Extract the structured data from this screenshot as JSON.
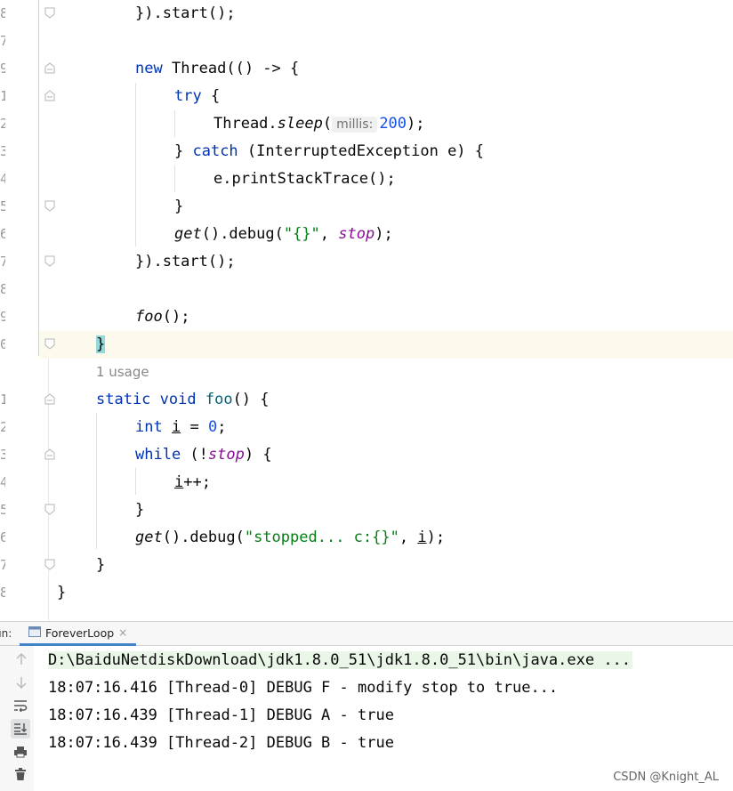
{
  "editor": {
    "line_numbers": [
      "8",
      "7",
      "9",
      "1",
      "2",
      "3",
      "4",
      "5",
      "6",
      "7",
      "8",
      "9",
      "0",
      "",
      "1",
      "2",
      "3",
      "4",
      "5",
      "6",
      "7",
      "8"
    ],
    "lines": {
      "l0": {
        "a": "}).start();"
      },
      "l2": {
        "kw": "new",
        "rest": " Thread(() -> {"
      },
      "l3": {
        "kw": "try",
        "rest": " {"
      },
      "l4": {
        "a": "Thread.",
        "it": "sleep",
        "b": "(",
        "hint": "millis:",
        "num": "200",
        "c": ");"
      },
      "l5": {
        "a": "} ",
        "kw": "catch",
        "rest": " (InterruptedException e) {"
      },
      "l6": {
        "a": "e.printStackTrace();"
      },
      "l7": {
        "a": "}"
      },
      "l8": {
        "it": "get",
        "a": "().debug(",
        "str": "\"{}\"",
        "b": ", ",
        "fld": "stop",
        "c": ");"
      },
      "l9": {
        "a": "}).start();"
      },
      "l11": {
        "it": "foo",
        "a": "();"
      },
      "l12": {
        "a": "}"
      },
      "l13": {
        "usage": "1 usage"
      },
      "l14": {
        "kw": "static void",
        "fn": "foo",
        "rest": "() {"
      },
      "l15": {
        "kw": "int",
        "var": "i",
        "a": " = ",
        "num": "0",
        "b": ";"
      },
      "l16": {
        "kw": "while",
        "a": " (!",
        "fld": "stop",
        "b": ") {"
      },
      "l17": {
        "var": "i",
        "a": "++;"
      },
      "l18": {
        "a": "}"
      },
      "l19": {
        "it": "get",
        "a": "().debug(",
        "str": "\"stopped... c:{}\"",
        "b": ", ",
        "var": "i",
        "c": ");"
      },
      "l20": {
        "a": "}"
      },
      "l21": {
        "a": "}"
      }
    }
  },
  "run_panel": {
    "label": "un:",
    "tab_title": "ForeverLoop",
    "tab_close": "×",
    "console_lines": [
      "D:\\BaiduNetdiskDownload\\jdk1.8.0_51\\jdk1.8.0_51\\bin\\java.exe ...",
      "18:07:16.416 [Thread-0] DEBUG F - modify stop to true...",
      "18:07:16.439 [Thread-1] DEBUG A - true",
      "18:07:16.439 [Thread-2] DEBUG B - true"
    ],
    "toolbar_icons": [
      "arrow-up-icon",
      "arrow-down-icon",
      "soft-wrap-icon",
      "scroll-to-end-icon",
      "print-icon",
      "trash-icon"
    ]
  },
  "watermark": "CSDN @Knight_AL",
  "colors": {
    "keyword": "#0033b3",
    "string": "#067d17",
    "number": "#1750eb",
    "field": "#871094",
    "method": "#00627a",
    "brace_highlight": "#93d9d9",
    "current_line": "#fcfaed"
  }
}
